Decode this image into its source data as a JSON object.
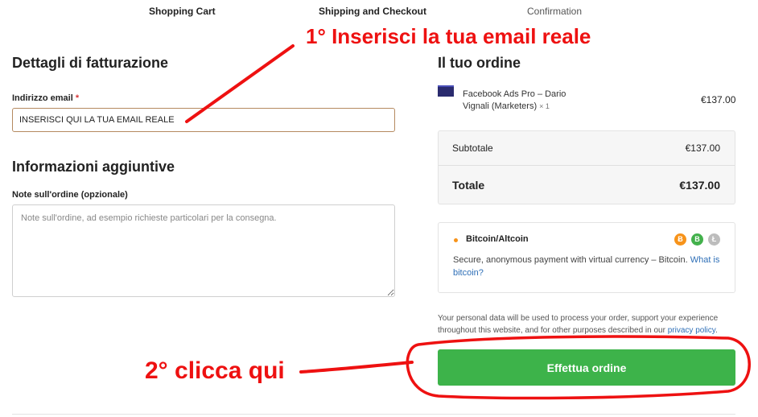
{
  "steps": [
    "Shopping Cart",
    "Shipping and Checkout",
    "Confirmation"
  ],
  "billing": {
    "title": "Dettagli di fatturazione",
    "email_label": "Indirizzo email",
    "email_required": "*",
    "email_value": "INSERISCI QUI LA TUA EMAIL REALE"
  },
  "additional": {
    "title": "Informazioni aggiuntive",
    "notes_label": "Note sull'ordine (opzionale)",
    "notes_placeholder": "Note sull'ordine, ad esempio richieste particolari per la consegna."
  },
  "order": {
    "title": "Il tuo ordine",
    "product_name": "Facebook Ads Pro – Dario Vignali (Marketers)",
    "product_qty": "× 1",
    "product_price": "€137.00",
    "subtotal_label": "Subtotale",
    "subtotal_value": "€137.00",
    "total_label": "Totale",
    "total_value": "€137.00"
  },
  "payment": {
    "method": "Bitcoin/Altcoin",
    "coins": [
      {
        "symbol": "Ƀ",
        "color": "#f7931a"
      },
      {
        "symbol": "B",
        "color": "#43b14c"
      },
      {
        "symbol": "Ł",
        "color": "#bdbdbd"
      }
    ],
    "description": "Secure, anonymous payment with virtual currency – Bitcoin.",
    "link_text": "What is bitcoin?"
  },
  "privacy": {
    "text": "Your personal data will be used to process your order, support your experience throughout this website, and for other purposes described in our",
    "link": "privacy policy",
    "end": "."
  },
  "place_order_label": "Effettua ordine",
  "annotations": {
    "step1": "1° Inserisci la tua email reale",
    "step2": "2° clicca qui",
    "color": "#ee1111"
  }
}
